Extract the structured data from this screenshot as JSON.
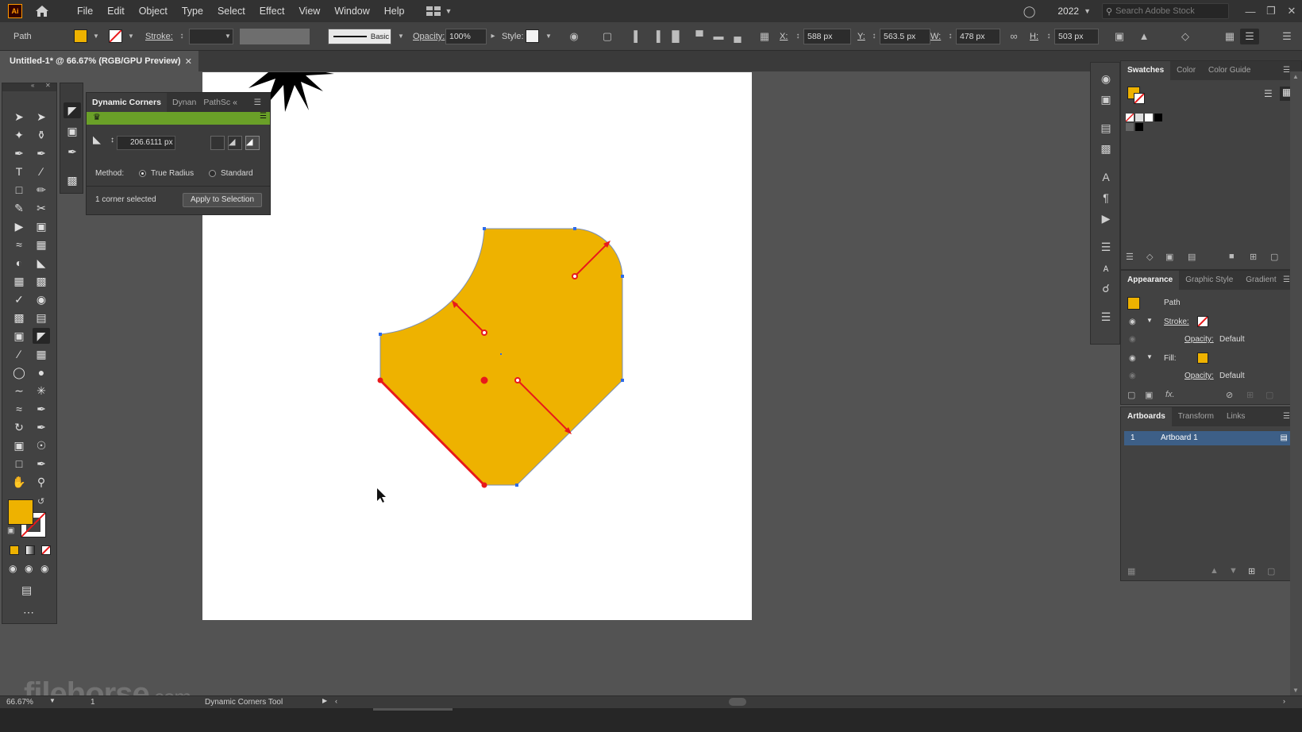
{
  "app": {
    "logo_text": "Ai"
  },
  "menu": [
    "File",
    "Edit",
    "Object",
    "Type",
    "Select",
    "Effect",
    "View",
    "Window",
    "Help"
  ],
  "menu_right": {
    "year": "2022",
    "search_placeholder": "Search Adobe Stock"
  },
  "control": {
    "selection_label": "Path",
    "stroke_label": "Stroke:",
    "brush_label": "Basic",
    "opacity_label": "Opacity:",
    "opacity_value": "100%",
    "style_label": "Style:",
    "x_label": "X:",
    "x_value": "588 px",
    "y_label": "Y:",
    "y_value": "563.5 px",
    "w_label": "W:",
    "w_value": "478 px",
    "h_label": "H:",
    "h_value": "503 px"
  },
  "document": {
    "tab_title": "Untitled-1* @ 66.67% (RGB/GPU Preview)"
  },
  "dynamic_corners": {
    "tabs": [
      "Dynamic Corners",
      "Dynan",
      "PathSc"
    ],
    "radius_value": "206.6111 px",
    "method_label": "Method:",
    "method_true_radius": "True Radius",
    "method_standard": "Standard",
    "selected_text": "1 corner selected",
    "apply_label": "Apply to Selection"
  },
  "swatches_panel": {
    "tabs": [
      "Swatches",
      "Color",
      "Color Guide"
    ]
  },
  "appearance_panel": {
    "tabs": [
      "Appearance",
      "Graphic Style",
      "Gradient"
    ],
    "object_label": "Path",
    "stroke_label": "Stroke:",
    "opacity_label": "Opacity:",
    "opacity_value": "Default",
    "fill_label": "Fill:",
    "fill_opacity_label": "Opacity:",
    "fill_opacity_value": "Default",
    "fx_label": "fx."
  },
  "artboards_panel": {
    "tabs": [
      "Artboards",
      "Transform",
      "Links"
    ],
    "rows": [
      {
        "number": "1",
        "name": "Artboard 1"
      }
    ]
  },
  "status": {
    "zoom": "66.67%",
    "page": "1",
    "tool_name": "Dynamic Corners Tool"
  },
  "watermark": {
    "main": "filehorse",
    "suffix": ".com"
  },
  "colors": {
    "fill": "#EEB200",
    "selection_red": "#E8191B",
    "anchor_blue": "#2D6BE8",
    "ui_bg": "#535353",
    "panel_green": "#6AA028"
  }
}
